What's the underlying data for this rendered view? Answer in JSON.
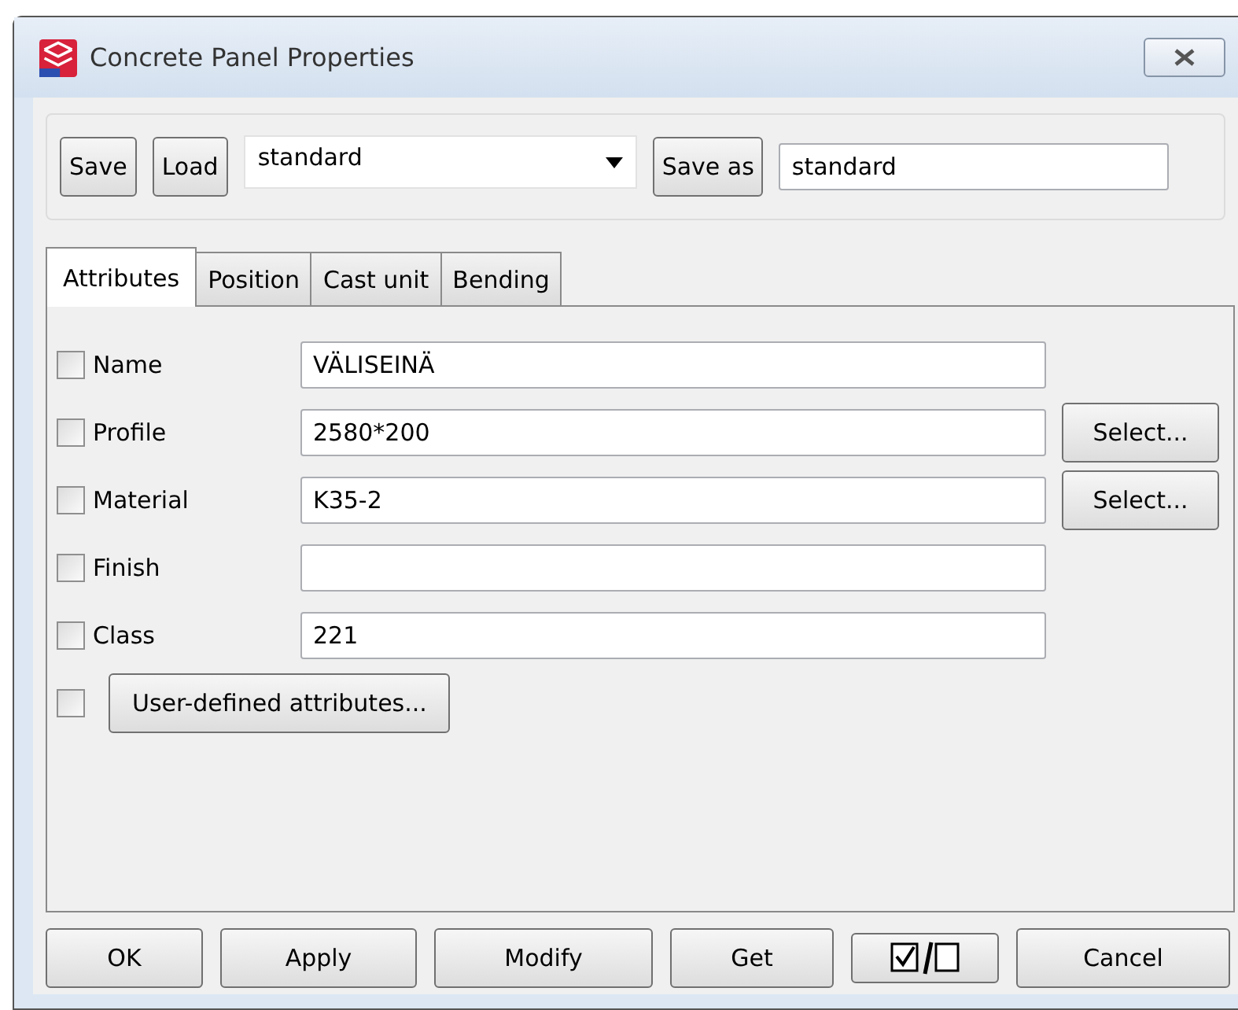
{
  "window": {
    "title": "Concrete Panel Properties"
  },
  "toolbar": {
    "save": "Save",
    "load": "Load",
    "preset": "standard",
    "save_as": "Save as",
    "save_as_name": "standard"
  },
  "tabs": [
    {
      "label": "Attributes",
      "selected": true
    },
    {
      "label": "Position",
      "selected": false
    },
    {
      "label": "Cast unit",
      "selected": false
    },
    {
      "label": "Bending",
      "selected": false
    }
  ],
  "attributes": [
    {
      "kind": "field",
      "label": "Name",
      "checked": false,
      "value": "VÄLISEINÄ"
    },
    {
      "kind": "field",
      "label": "Profile",
      "checked": false,
      "value": "2580*200",
      "button": "Select..."
    },
    {
      "kind": "field",
      "label": "Material",
      "checked": false,
      "value": "K35-2",
      "button": "Select..."
    },
    {
      "kind": "field",
      "label": "Finish",
      "checked": false
    },
    {
      "kind": "field",
      "label": "Class",
      "checked": false,
      "value": "221"
    },
    {
      "kind": "button",
      "checked": false,
      "button": "User-defined attributes..."
    }
  ],
  "buttons": [
    "OK",
    "Apply",
    "Modify",
    "Get"
  ],
  "toggle": {
    "on": true
  },
  "cancel": "Cancel"
}
